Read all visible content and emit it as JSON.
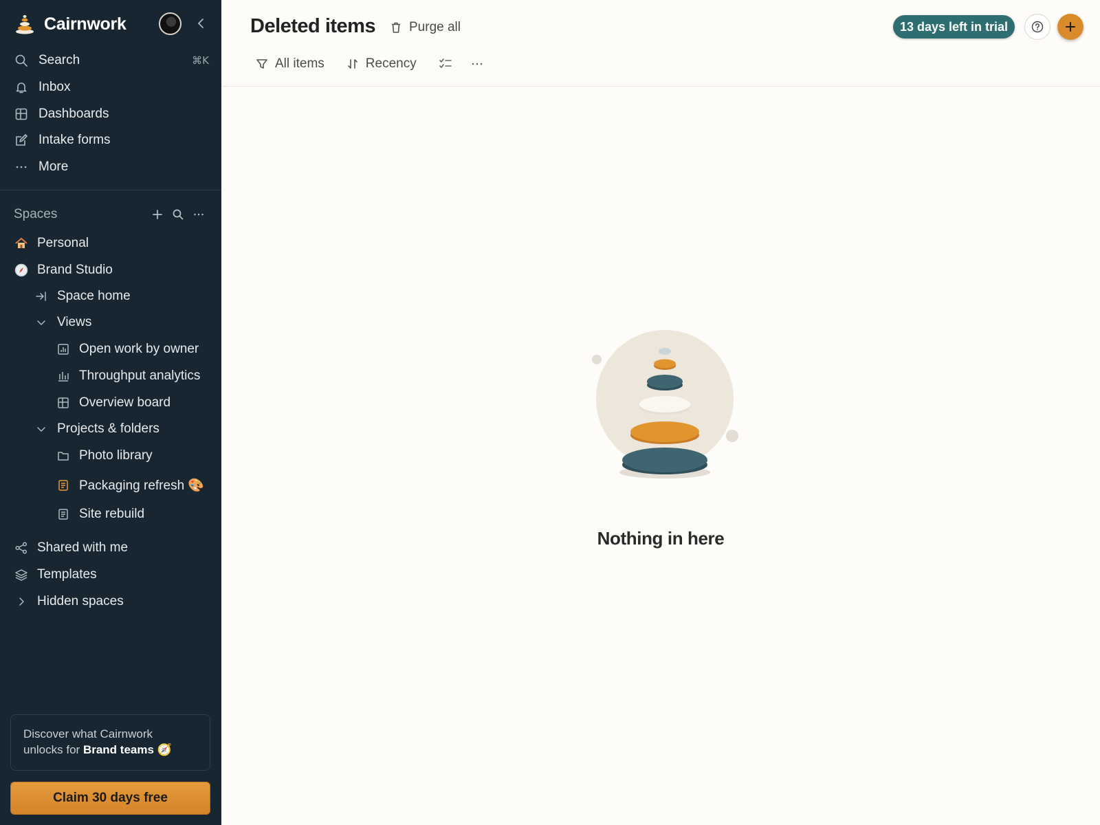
{
  "sidebar": {
    "brand": "Cairnwork",
    "nav": [
      {
        "label": "Search",
        "icon": "search-icon",
        "shortcut": "⌘K"
      },
      {
        "label": "Inbox",
        "icon": "bell-icon"
      },
      {
        "label": "Dashboards",
        "icon": "dashboard-icon"
      },
      {
        "label": "Intake forms",
        "icon": "form-edit-icon"
      },
      {
        "label": "More",
        "icon": "more-dots-icon"
      }
    ],
    "spaces_label": "Spaces",
    "tree": {
      "personal": "Personal",
      "brand_studio": "Brand Studio",
      "space_home": "Space home",
      "views": "Views",
      "open_work": "Open work by owner",
      "throughput": "Throughput analytics",
      "overview": "Overview board",
      "projects": "Projects & folders",
      "photo_library": "Photo library",
      "packaging": "Packaging refresh 🎨",
      "site_rebuild": "Site rebuild",
      "shared": "Shared with me",
      "templates": "Templates",
      "hidden": "Hidden spaces"
    },
    "promo": {
      "line1": "Discover what Cairnwork",
      "line2_prefix": "unlocks for ",
      "line2_bold": "Brand teams",
      "line2_suffix": " 🧭"
    },
    "claim_button": "Claim 30 days free"
  },
  "header": {
    "title": "Deleted items",
    "purge": "Purge all",
    "trial": "13 days left in trial"
  },
  "toolbar": {
    "filter": "All items",
    "sort": "Recency"
  },
  "empty_state": {
    "message": "Nothing in here"
  },
  "colors": {
    "sidebar_bg": "#172630",
    "accent_orange": "#d98b2c",
    "trial_teal": "#2f6e70",
    "page_bg": "#fdfcf9"
  }
}
